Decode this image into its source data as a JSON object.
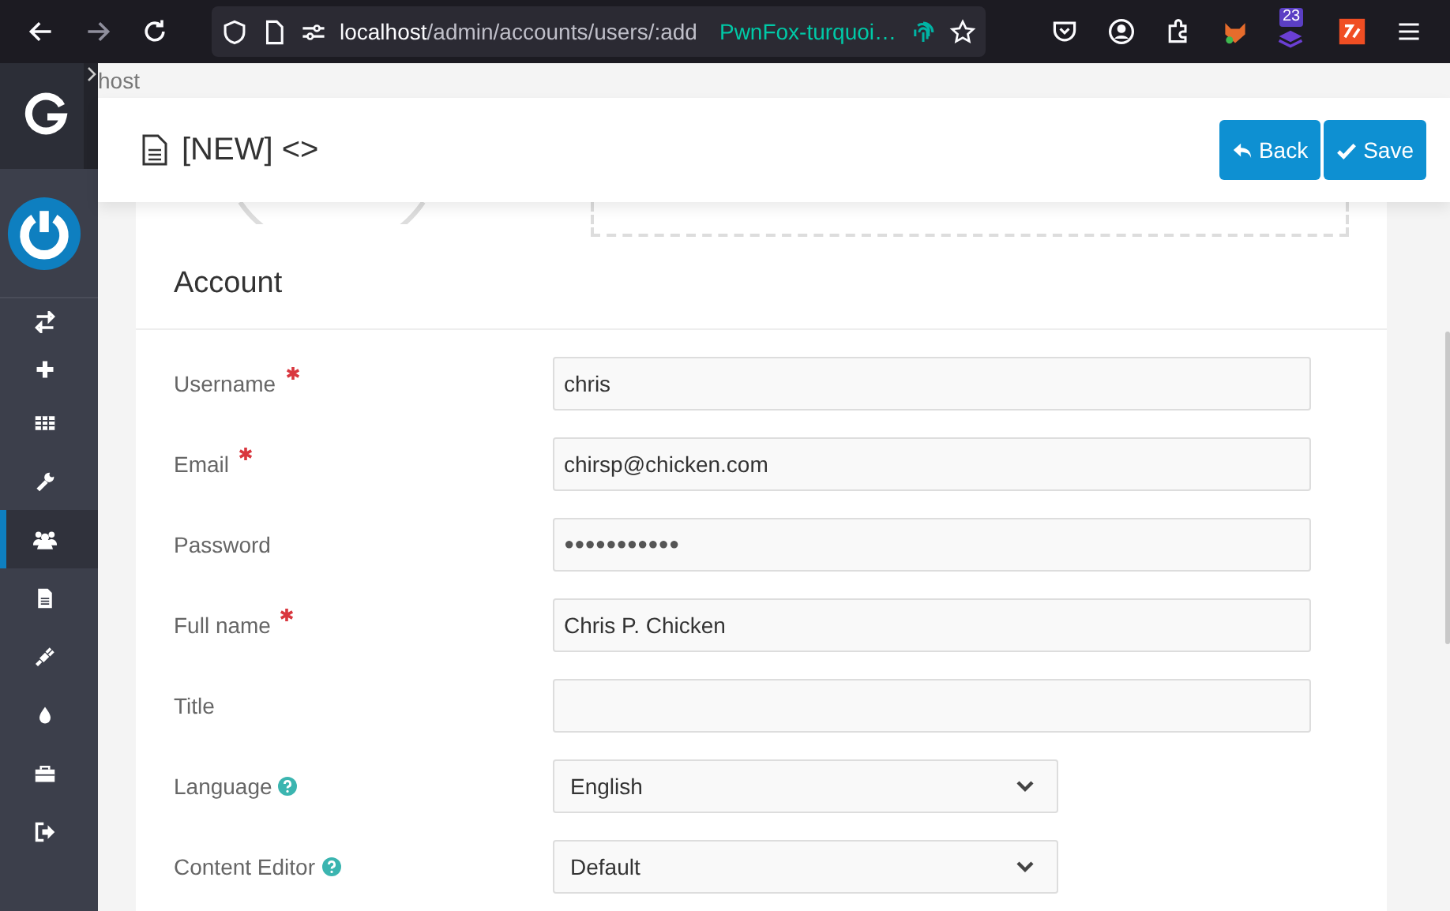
{
  "browser": {
    "url_host": "localhost",
    "url_path": "/admin/accounts/users/:add",
    "container_label": "PwnFox-turquoi…",
    "extension_badge": "23"
  },
  "tab_strip": {
    "text": "host"
  },
  "sidebar": {
    "items": [
      {
        "kind": "sync",
        "selected": false
      },
      {
        "kind": "plus",
        "selected": false
      },
      {
        "kind": "grid",
        "selected": false
      },
      {
        "kind": "wrench",
        "selected": false
      },
      {
        "kind": "users",
        "selected": true
      },
      {
        "kind": "document",
        "selected": false
      },
      {
        "kind": "plug",
        "selected": false
      },
      {
        "kind": "drop",
        "selected": false
      },
      {
        "kind": "briefcase",
        "selected": false
      },
      {
        "kind": "signout",
        "selected": false
      }
    ]
  },
  "header": {
    "title": "[NEW] <>",
    "buttons": [
      {
        "kind": "back",
        "label": "Back"
      },
      {
        "kind": "save",
        "label": "Save"
      }
    ]
  },
  "section": {
    "heading": "Account"
  },
  "fields": [
    {
      "kind": "text",
      "label": "Username",
      "required": true,
      "value": "chris"
    },
    {
      "kind": "text",
      "label": "Email",
      "required": true,
      "value": "chirsp@chicken.com"
    },
    {
      "kind": "password",
      "label": "Password",
      "value": "●●●●●●●●●●●"
    },
    {
      "kind": "text",
      "label": "Full name",
      "required": true,
      "value": "Chris P. Chicken"
    },
    {
      "kind": "text",
      "label": "Title"
    },
    {
      "kind": "select",
      "label": "Language",
      "help": true,
      "value": "English"
    },
    {
      "kind": "select",
      "label": "Content Editor",
      "help": true,
      "value": "Default"
    }
  ]
}
